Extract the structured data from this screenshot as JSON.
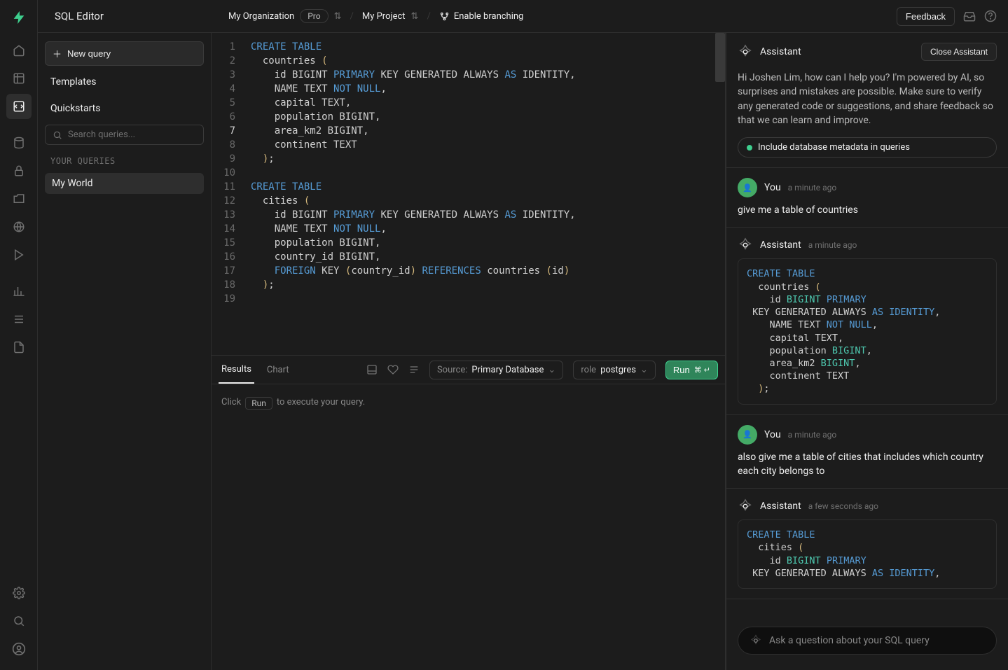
{
  "header": {
    "title": "SQL Editor",
    "org": "My Organization",
    "plan": "Pro",
    "project": "My Project",
    "branching": "Enable branching",
    "feedback": "Feedback"
  },
  "sidebar": {
    "new_query": "New query",
    "templates": "Templates",
    "quickstarts": "Quickstarts",
    "search_placeholder": "Search queries...",
    "section_label": "YOUR QUERIES",
    "queries": [
      "My World"
    ]
  },
  "editor": {
    "lines": [
      {
        "n": 1,
        "tokens": [
          [
            "kw",
            "CREATE"
          ],
          [
            "sp",
            " "
          ],
          [
            "kw",
            "TABLE"
          ]
        ]
      },
      {
        "n": 2,
        "tokens": [
          [
            "txt",
            "  countries "
          ],
          [
            "pn",
            "("
          ]
        ]
      },
      {
        "n": 3,
        "tokens": [
          [
            "txt",
            "    id BIGINT "
          ],
          [
            "kw",
            "PRIMARY"
          ],
          [
            "txt",
            " KEY GENERATED ALWAYS "
          ],
          [
            "kw",
            "AS"
          ],
          [
            "txt",
            " IDENTITY,"
          ]
        ]
      },
      {
        "n": 4,
        "tokens": [
          [
            "txt",
            "    NAME TEXT "
          ],
          [
            "kw",
            "NOT"
          ],
          [
            "txt",
            " "
          ],
          [
            "kw",
            "NULL"
          ],
          [
            "txt",
            ","
          ]
        ]
      },
      {
        "n": 5,
        "tokens": [
          [
            "txt",
            "    capital TEXT,"
          ]
        ]
      },
      {
        "n": 6,
        "tokens": [
          [
            "txt",
            "    population BIGINT,"
          ]
        ]
      },
      {
        "n": 7,
        "tokens": [
          [
            "txt",
            "    area_km2 BIGINT,"
          ]
        ]
      },
      {
        "n": 8,
        "tokens": [
          [
            "txt",
            "    continent TEXT"
          ]
        ]
      },
      {
        "n": 9,
        "tokens": [
          [
            "txt",
            "  "
          ],
          [
            "pn",
            ")"
          ],
          [
            "txt",
            ";"
          ]
        ]
      },
      {
        "n": 10,
        "tokens": []
      },
      {
        "n": 11,
        "tokens": [
          [
            "kw",
            "CREATE"
          ],
          [
            "sp",
            " "
          ],
          [
            "kw",
            "TABLE"
          ]
        ]
      },
      {
        "n": 12,
        "tokens": [
          [
            "txt",
            "  cities "
          ],
          [
            "pn",
            "("
          ]
        ]
      },
      {
        "n": 13,
        "tokens": [
          [
            "txt",
            "    id BIGINT "
          ],
          [
            "kw",
            "PRIMARY"
          ],
          [
            "txt",
            " KEY GENERATED ALWAYS "
          ],
          [
            "kw",
            "AS"
          ],
          [
            "txt",
            " IDENTITY,"
          ]
        ]
      },
      {
        "n": 14,
        "tokens": [
          [
            "txt",
            "    NAME TEXT "
          ],
          [
            "kw",
            "NOT"
          ],
          [
            "txt",
            " "
          ],
          [
            "kw",
            "NULL"
          ],
          [
            "txt",
            ","
          ]
        ]
      },
      {
        "n": 15,
        "tokens": [
          [
            "txt",
            "    population BIGINT,"
          ]
        ]
      },
      {
        "n": 16,
        "tokens": [
          [
            "txt",
            "    country_id BIGINT,"
          ]
        ]
      },
      {
        "n": 17,
        "tokens": [
          [
            "txt",
            "    "
          ],
          [
            "kw",
            "FOREIGN"
          ],
          [
            "txt",
            " KEY "
          ],
          [
            "pn",
            "("
          ],
          [
            "txt",
            "country_id"
          ],
          [
            "pn",
            ")"
          ],
          [
            "txt",
            " "
          ],
          [
            "kw",
            "REFERENCES"
          ],
          [
            "txt",
            " countries "
          ],
          [
            "pn",
            "("
          ],
          [
            "txt",
            "id"
          ],
          [
            "pn",
            ")"
          ]
        ]
      },
      {
        "n": 18,
        "tokens": [
          [
            "txt",
            "  "
          ],
          [
            "pn",
            ")"
          ],
          [
            "txt",
            ";"
          ]
        ]
      },
      {
        "n": 19,
        "tokens": []
      }
    ],
    "highlighted_line": 7
  },
  "results": {
    "tab_results": "Results",
    "tab_chart": "Chart",
    "source_label": "Source:",
    "source_value": "Primary Database",
    "role_label": "role",
    "role_value": "postgres",
    "run_label": "Run",
    "run_shortcut": "⌘ ↵",
    "hint_pre": "Click",
    "hint_kbd": "Run",
    "hint_post": "to execute your query."
  },
  "assistant": {
    "title": "Assistant",
    "close": "Close Assistant",
    "intro": "Hi Joshen Lim, how can I help you? I'm powered by AI, so surprises and mistakes are possible. Make sure to verify any generated code or suggestions, and share feedback so that we can learn and improve.",
    "include_meta": "Include database metadata in queries",
    "input_placeholder": "Ask a question about your SQL query",
    "messages": [
      {
        "role": "You",
        "time": "a minute ago",
        "text": "give me a table of countries"
      },
      {
        "role": "Assistant",
        "time": "a minute ago",
        "code": [
          [
            [
              "kw",
              "CREATE"
            ],
            [
              "txt",
              " "
            ],
            [
              "kw",
              "TABLE"
            ]
          ],
          [
            [
              "txt",
              "  countries "
            ],
            [
              "pn",
              "("
            ]
          ],
          [
            [
              "txt",
              "    id "
            ],
            [
              "kw2",
              "BIGINT"
            ],
            [
              "txt",
              " "
            ],
            [
              "kw",
              "PRIMARY"
            ]
          ],
          [
            [
              "txt",
              " KEY GENERATED ALWAYS "
            ],
            [
              "kw",
              "AS"
            ],
            [
              "txt",
              " "
            ],
            [
              "kw",
              "IDENTITY"
            ],
            [
              "txt",
              ","
            ]
          ],
          [
            [
              "txt",
              "    NAME TEXT "
            ],
            [
              "kw",
              "NOT"
            ],
            [
              "txt",
              " "
            ],
            [
              "kw",
              "NULL"
            ],
            [
              "txt",
              ","
            ]
          ],
          [
            [
              "txt",
              "    capital TEXT,"
            ]
          ],
          [
            [
              "txt",
              "    population "
            ],
            [
              "kw2",
              "BIGINT"
            ],
            [
              "txt",
              ","
            ]
          ],
          [
            [
              "txt",
              "    area_km2 "
            ],
            [
              "kw2",
              "BIGINT"
            ],
            [
              "txt",
              ","
            ]
          ],
          [
            [
              "txt",
              "    continent TEXT"
            ]
          ],
          [
            [
              "txt",
              "  "
            ],
            [
              "pn",
              ")"
            ],
            [
              "txt",
              ";"
            ]
          ]
        ]
      },
      {
        "role": "You",
        "time": "a minute ago",
        "text": "also give me a table of cities that includes which country each city belongs to"
      },
      {
        "role": "Assistant",
        "time": "a few seconds ago",
        "code": [
          [
            [
              "kw",
              "CREATE"
            ],
            [
              "txt",
              " "
            ],
            [
              "kw",
              "TABLE"
            ]
          ],
          [
            [
              "txt",
              "  cities "
            ],
            [
              "pn",
              "("
            ]
          ],
          [
            [
              "txt",
              "    id "
            ],
            [
              "kw2",
              "BIGINT"
            ],
            [
              "txt",
              " "
            ],
            [
              "kw",
              "PRIMARY"
            ]
          ],
          [
            [
              "txt",
              " KEY GENERATED ALWAYS "
            ],
            [
              "kw",
              "AS"
            ],
            [
              "txt",
              " "
            ],
            [
              "kw",
              "IDENTITY"
            ],
            [
              "txt",
              ","
            ]
          ]
        ]
      }
    ]
  }
}
